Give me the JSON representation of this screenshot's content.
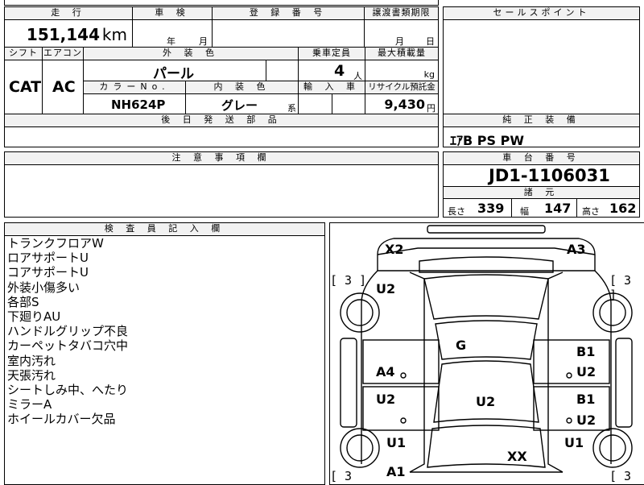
{
  "top_row": {
    "mileage_label": "走 行",
    "mileage_value": "151,144",
    "mileage_unit": "km",
    "inspection_label": "車 検",
    "inspection_year": "年",
    "inspection_month": "月",
    "registration_label": "登 録 番 号",
    "transfer_label": "譲渡書類期限",
    "transfer_month": "月",
    "transfer_day": "日"
  },
  "second_row": {
    "shift_label": "シフト",
    "shift_value": "CAT",
    "aircon_label": "エアコン",
    "aircon_value": "AC",
    "exterior_color_label": "外 装 色",
    "exterior_color_value": "パール",
    "capacity_label": "乗車定員",
    "capacity_value": "4",
    "capacity_unit": "人",
    "max_load_label": "最大積載量",
    "max_load_unit": "kg",
    "color_no_label": "カラーNo.",
    "color_no_value": "NH624P",
    "interior_color_label": "内 装 色",
    "interior_color_value": "グレー",
    "interior_color_suffix": "系",
    "import_label": "輸 入 車",
    "recycle_label": "リサイクル預託金",
    "recycle_value": "9,430",
    "recycle_unit": "円"
  },
  "later_parts_label": "後 日 発 送 部 品",
  "sales_point_label": "セールスポイント",
  "standard_equipment_label": "純 正 装 備",
  "standard_equipment_value": "ｴｱB PS PW",
  "caution_label": "注 意 事 項 欄",
  "chassis_label": "車 台 番 号",
  "chassis_value": "JD1-1106031",
  "specs_label": "諸 元",
  "specs": {
    "length_label": "長さ",
    "length_value": "339",
    "width_label": "幅",
    "width_value": "147",
    "height_label": "高さ",
    "height_value": "162"
  },
  "inspector_label": "検 査 員 記 入 欄",
  "inspector_notes": [
    "トランクフロアW",
    "ロアサポートU",
    "コアサポートU",
    "外装小傷多い",
    "各部S",
    "下廻りAU",
    "ハンドルグリップ不良",
    "カーペットタバコ穴中",
    "室内汚れ",
    "天張汚れ",
    "シートしみ中、へたり",
    "ミラーA",
    "ホイールカバー欠品"
  ],
  "damage_marks": {
    "rear_left": "X2",
    "rear_right": "A3",
    "rear_quarter_left": "U2",
    "roof": "G",
    "rear_door_right_1": "B1",
    "rear_door_right_2": "U2",
    "rear_door_left": "A4",
    "front_door_left": "U2",
    "floor": "U2",
    "front_door_right_1": "B1",
    "front_door_right_2": "U2",
    "front_fender_left": "U1",
    "front_fender_right": "U1",
    "hood": "XX",
    "front_left": "A1"
  },
  "tire_marks": [
    "[ 3 ]",
    "[ 3 ]",
    "[ 3",
    "[ 3"
  ]
}
